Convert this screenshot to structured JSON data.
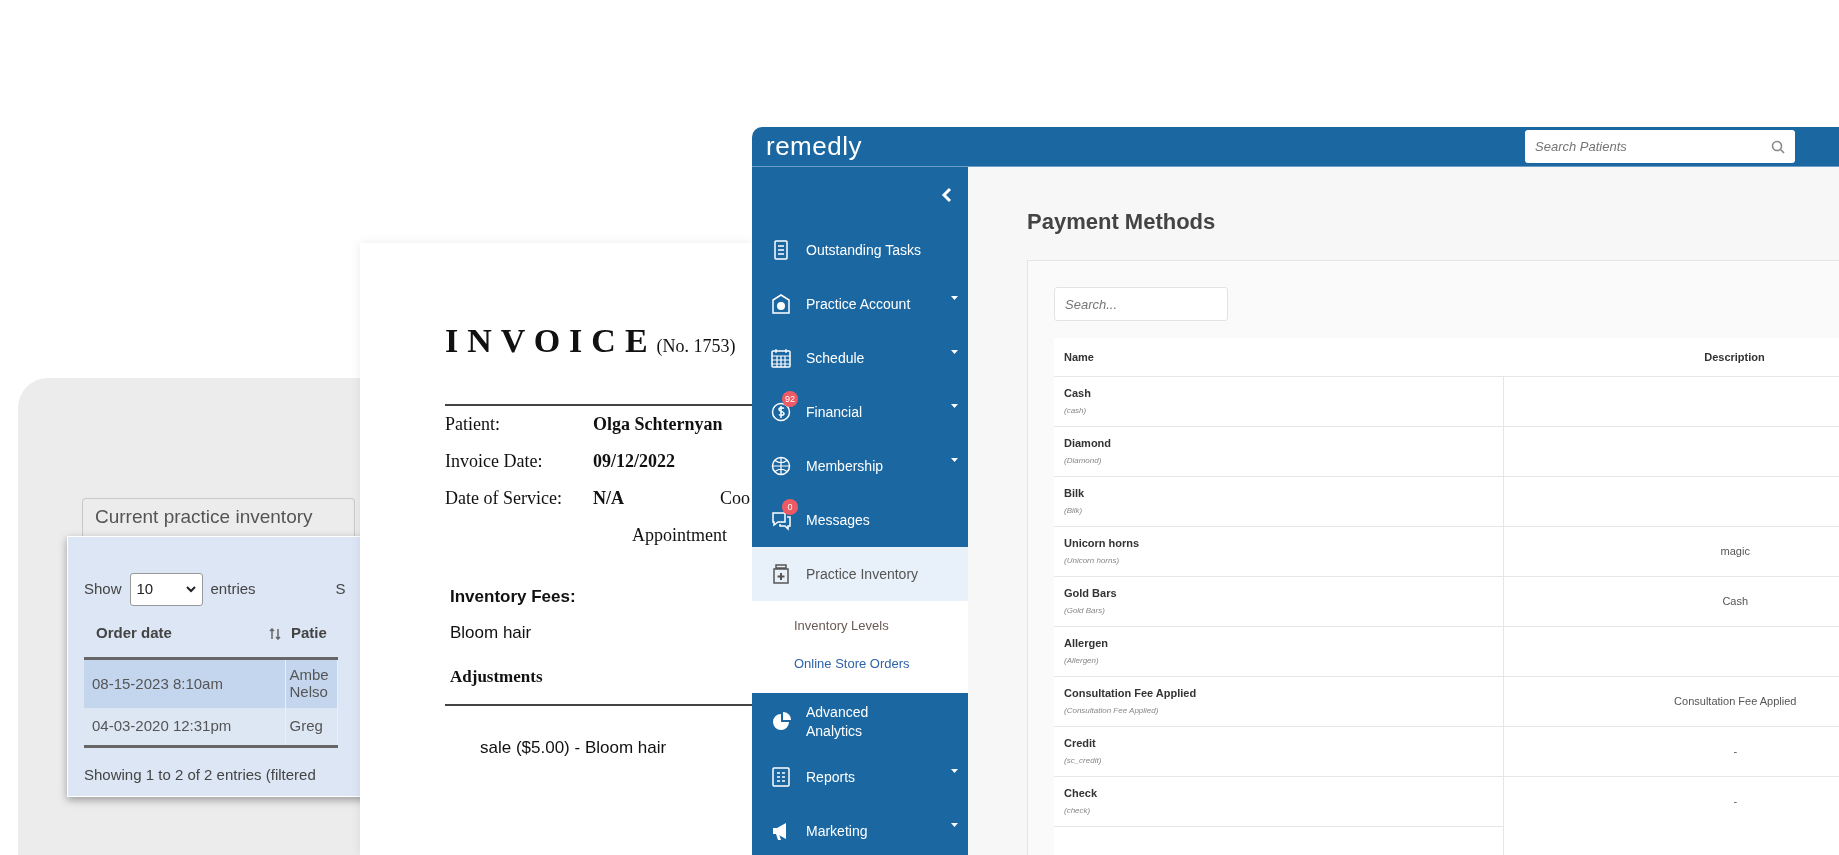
{
  "inventory_widget": {
    "tab": "Current practice inventory",
    "show_label": "Show",
    "page_size": "10",
    "entries_label": "entries",
    "search_label": "S",
    "columns": [
      "Order date",
      "Patie"
    ],
    "rows": [
      {
        "order_date": "08-15-2023 8:10am",
        "patient": "Ambe Nelso",
        "selected": true
      },
      {
        "order_date": "04-03-2020 12:31pm",
        "patient": "Greg",
        "selected": false
      }
    ],
    "footer": "Showing 1 to 2 of 2 entries (filtered"
  },
  "invoice": {
    "title": "INVOICE",
    "number": "(No. 1753)",
    "fields": [
      {
        "label": "Patient:",
        "value": "Olga Schternyan"
      },
      {
        "label": "Invoice Date:",
        "value": "09/12/2022"
      },
      {
        "label": "Date of Service:",
        "value": "N/A",
        "column_3": "Coo"
      }
    ],
    "appointment_label": "Appointment",
    "inventory_heading": "Inventory Fees:",
    "inventory_items": [
      "Bloom hair"
    ],
    "adjustments_heading": "Adjustments",
    "adjustments": [
      "sale ($5.00) - Bloom hair"
    ]
  },
  "app": {
    "logo": "remedly",
    "search": {
      "placeholder": "Search Patients"
    },
    "sidebar": {
      "items": [
        {
          "label": "Outstanding Tasks",
          "has_submenu": false,
          "expanded": false
        },
        {
          "label": "Practice Account",
          "has_submenu": true,
          "expanded": false
        },
        {
          "label": "Schedule",
          "has_submenu": true,
          "expanded": false
        },
        {
          "label": "Financial",
          "has_submenu": true,
          "expanded": false,
          "badge": "92"
        },
        {
          "label": "Membership",
          "has_submenu": true,
          "expanded": false
        },
        {
          "label": "Messages",
          "has_submenu": false,
          "expanded": false,
          "badge": "0"
        },
        {
          "label": "Practice Inventory",
          "has_submenu": false,
          "expanded": true,
          "children": [
            {
              "label": "Inventory Levels",
              "selected": false
            },
            {
              "label": "Online Store Orders",
              "selected": true
            }
          ]
        },
        {
          "label": "Advanced Analytics",
          "has_submenu": false,
          "expanded": false
        },
        {
          "label": "Reports",
          "has_submenu": true,
          "expanded": false
        },
        {
          "label": "Marketing",
          "has_submenu": true,
          "expanded": false
        }
      ]
    },
    "page_title": "Payment Methods",
    "table_search": {
      "placeholder": "Search..."
    },
    "table": {
      "columns": [
        "Name",
        "Description"
      ],
      "rows": [
        {
          "name": "Cash",
          "code": "(cash)"
        },
        {
          "name": "Diamond",
          "code": "(Diamond)"
        },
        {
          "name": "Bilk",
          "code": "(Bilk)"
        },
        {
          "name": "Unicorn horns",
          "code": "(Unicorn horns)",
          "description": "magic"
        },
        {
          "name": "Gold Bars",
          "code": "(Gold Bars)",
          "description": "Cash"
        },
        {
          "name": "Allergen",
          "code": "(Allergen)"
        },
        {
          "name": "Consultation Fee Applied",
          "code": "(Consultation Fee Applied)",
          "description": "Consultation Fee Applied"
        },
        {
          "name": "Credit",
          "code": "(sc_credit)",
          "description": "-"
        },
        {
          "name": "Check",
          "code": "(check)",
          "description": "-"
        }
      ]
    }
  }
}
